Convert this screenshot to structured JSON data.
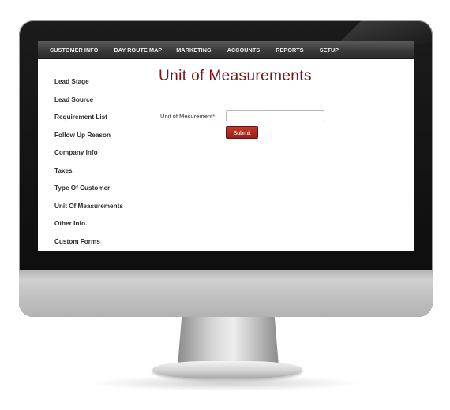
{
  "nav": {
    "items": [
      "CUSTOMER INFO",
      "DAY ROUTE MAP",
      "MARKETING",
      "ACCOUNTS",
      "REPORTS",
      "SETUP"
    ]
  },
  "sidebar": {
    "items": [
      "Lead Stage",
      "Lead Source",
      "Requirement List",
      "Follow Up Reason",
      "Company Info",
      "Taxes",
      "Type Of Customer",
      "Unit Of Measurements",
      "Other Info.",
      "Custom Forms"
    ]
  },
  "main": {
    "title": "Unit of Measurements",
    "form": {
      "label": "Unit of Mesurement",
      "required_mark": "*",
      "input_value": "",
      "submit_label": "Submit"
    }
  },
  "colors": {
    "title": "#7a1212",
    "button": "#a82a1e",
    "nav_bg": "#3a3a3a"
  }
}
